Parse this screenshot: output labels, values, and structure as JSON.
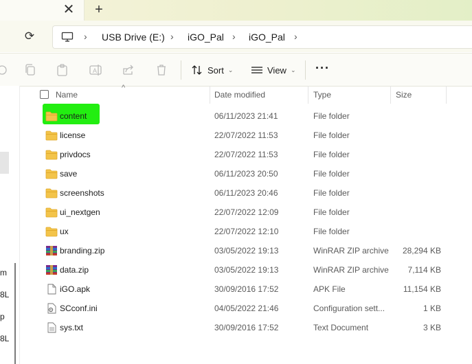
{
  "tab": {
    "close_glyph": "✕",
    "new_tab_glyph": "+"
  },
  "nav": {
    "refresh_glyph": "⟳"
  },
  "address": {
    "crumbs": [
      "USB Drive (E:)",
      "iGO_Pal",
      "iGO_Pal"
    ],
    "separator": "›"
  },
  "commands": {
    "sort_label": "Sort",
    "view_label": "View",
    "more_label": "···",
    "icons": [
      "cut-icon",
      "copy-icon",
      "paste-icon",
      "rename-icon",
      "share-icon",
      "delete-icon"
    ]
  },
  "left_pane_fragments": [
    "m",
    "8L",
    "p",
    "8L"
  ],
  "columns": {
    "name": "Name",
    "date": "Date modified",
    "type": "Type",
    "size": "Size"
  },
  "files": [
    {
      "name": "content",
      "date": "06/11/2023 21:41",
      "type": "File folder",
      "size": "",
      "kind": "folder",
      "highlight": true
    },
    {
      "name": "license",
      "date": "22/07/2022 11:53",
      "type": "File folder",
      "size": "",
      "kind": "folder"
    },
    {
      "name": "privdocs",
      "date": "22/07/2022 11:53",
      "type": "File folder",
      "size": "",
      "kind": "folder"
    },
    {
      "name": "save",
      "date": "06/11/2023 20:50",
      "type": "File folder",
      "size": "",
      "kind": "folder"
    },
    {
      "name": "screenshots",
      "date": "06/11/2023 20:46",
      "type": "File folder",
      "size": "",
      "kind": "folder"
    },
    {
      "name": "ui_nextgen",
      "date": "22/07/2022 12:09",
      "type": "File folder",
      "size": "",
      "kind": "folder"
    },
    {
      "name": "ux",
      "date": "22/07/2022 12:10",
      "type": "File folder",
      "size": "",
      "kind": "folder"
    },
    {
      "name": "branding.zip",
      "date": "03/05/2022 19:13",
      "type": "WinRAR ZIP archive",
      "size": "28,294 KB",
      "kind": "zip"
    },
    {
      "name": "data.zip",
      "date": "03/05/2022 19:13",
      "type": "WinRAR ZIP archive",
      "size": "7,114 KB",
      "kind": "zip"
    },
    {
      "name": "iGO.apk",
      "date": "30/09/2016 17:52",
      "type": "APK File",
      "size": "11,154 KB",
      "kind": "file"
    },
    {
      "name": "SCconf.ini",
      "date": "04/05/2022 21:46",
      "type": "Configuration sett...",
      "size": "1 KB",
      "kind": "ini"
    },
    {
      "name": "sys.txt",
      "date": "30/09/2016 17:52",
      "type": "Text Document",
      "size": "3 KB",
      "kind": "txt"
    }
  ],
  "colors": {
    "highlight": "#22ee11",
    "folder": "#f3c44a",
    "folder_dark": "#e0a92b"
  }
}
